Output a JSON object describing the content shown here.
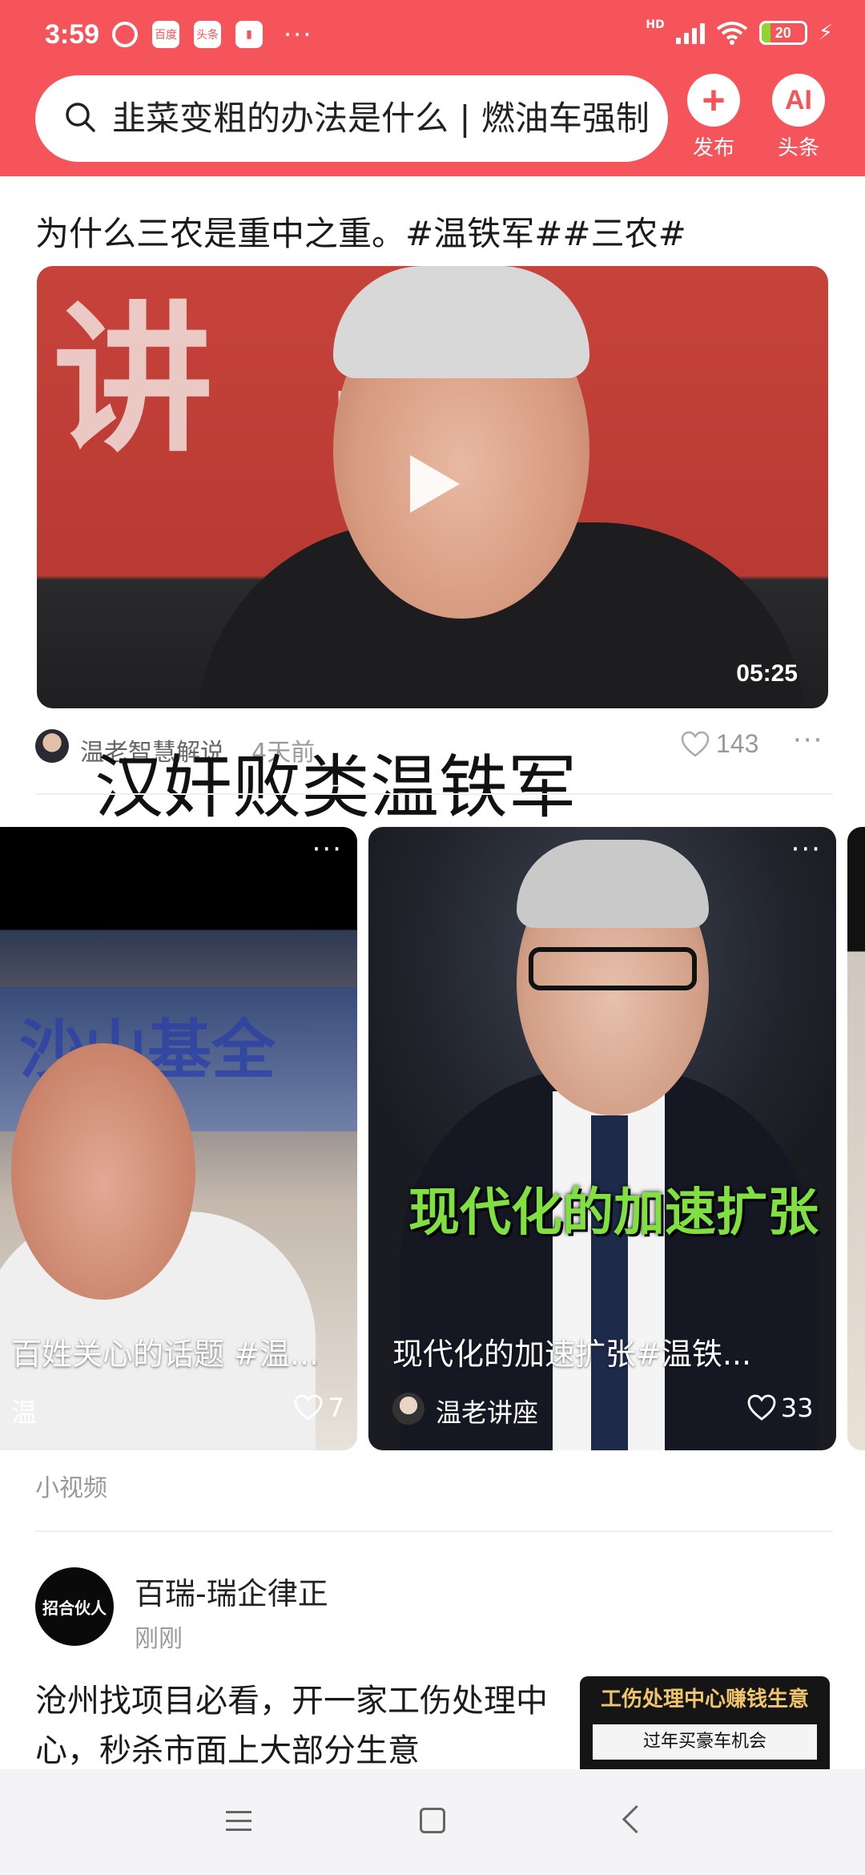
{
  "status_bar": {
    "time": "3:59",
    "app_badge_1": "百度",
    "app_badge_2": "头条",
    "more": "···",
    "hd": "HD",
    "battery": "20"
  },
  "header": {
    "search_text": "韭菜变粗的办法是什么 | 燃油车强制",
    "publish_label": "发布",
    "ai_label": "AI",
    "toutiao_label": "头条"
  },
  "article1": {
    "title": "为什么三农是重中之重。#温铁军##三农#",
    "video_bg_text": "讲 兵",
    "duration": "05:25",
    "author": "温老智慧解说",
    "time": "4天前",
    "likes": "143",
    "overlay": "汉奸败类温铁军"
  },
  "shorts": {
    "left": {
      "banner": "沙山基全",
      "title": "百姓关心的话题 #温...",
      "author": "温",
      "likes": "7"
    },
    "middle": {
      "caption": "现代化的加速扩张",
      "title": "现代化的加速扩张#温铁...",
      "author": "温老讲座",
      "likes": "33"
    },
    "section_label": "小视频"
  },
  "article2": {
    "avatar_text": "招合伙人",
    "author": "百瑞-瑞企律正",
    "time": "刚刚",
    "text": "沧州找项目必看，开一家工伤处理中心，秒杀市面上大部分生意",
    "thumb_line1": "工伤处理中心赚钱生意",
    "thumb_line2": "过年买豪车机会"
  },
  "colors": {
    "brand": "#f5545a",
    "accent_green": "#7fe040"
  }
}
